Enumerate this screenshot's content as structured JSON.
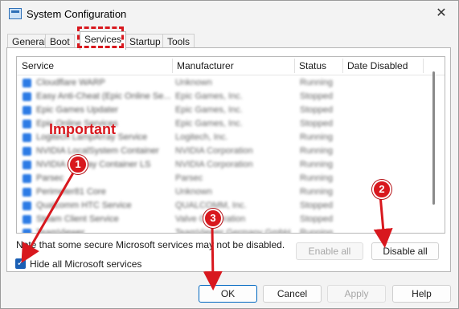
{
  "window": {
    "title": "System Configuration",
    "close_glyph": "✕"
  },
  "tabs": [
    {
      "label": "General"
    },
    {
      "label": "Boot"
    },
    {
      "label": "Services"
    },
    {
      "label": "Startup"
    },
    {
      "label": "Tools"
    }
  ],
  "services_table": {
    "columns": [
      "Service",
      "Manufacturer",
      "Status",
      "Date Disabled"
    ],
    "rows": [
      {
        "service": "Cloudflare WARP",
        "manufacturer": "Unknown",
        "status": "Running"
      },
      {
        "service": "Easy Anti-Cheat (Epic Online Se...",
        "manufacturer": "Epic Games, Inc.",
        "status": "Stopped"
      },
      {
        "service": "Epic Games Updater",
        "manufacturer": "Epic Games, Inc.",
        "status": "Stopped"
      },
      {
        "service": "Epic Online Services",
        "manufacturer": "Epic Games, Inc.",
        "status": "Stopped"
      },
      {
        "service": "Logitech LampArray Service",
        "manufacturer": "Logitech, Inc.",
        "status": "Running"
      },
      {
        "service": "NVIDIA LocalSystem Container",
        "manufacturer": "NVIDIA Corporation",
        "status": "Running"
      },
      {
        "service": "NVIDIA Display Container LS",
        "manufacturer": "NVIDIA Corporation",
        "status": "Running"
      },
      {
        "service": "Parsec",
        "manufacturer": "Parsec",
        "status": "Running"
      },
      {
        "service": "Perimeter81 Core",
        "manufacturer": "Unknown",
        "status": "Running"
      },
      {
        "service": "Qualcomm HTC Service",
        "manufacturer": "QUALCOMM, Inc.",
        "status": "Stopped"
      },
      {
        "service": "Steam Client Service",
        "manufacturer": "Valve Corporation",
        "status": "Stopped"
      },
      {
        "service": "TeamViewer",
        "manufacturer": "TeamViewer Germany GmbH",
        "status": "Running"
      }
    ]
  },
  "note": "Note that some secure Microsoft services may not be disabled.",
  "hide_microsoft": {
    "label": "Hide all Microsoft services",
    "checked": true,
    "check_glyph": "✓"
  },
  "buttons": {
    "enable_all": "Enable all",
    "disable_all": "Disable all",
    "ok": "OK",
    "cancel": "Cancel",
    "apply": "Apply",
    "help": "Help"
  },
  "annotations": {
    "important": "Important",
    "badge_1": "1",
    "badge_2": "2",
    "badge_3": "3",
    "color": "#d8181e"
  }
}
